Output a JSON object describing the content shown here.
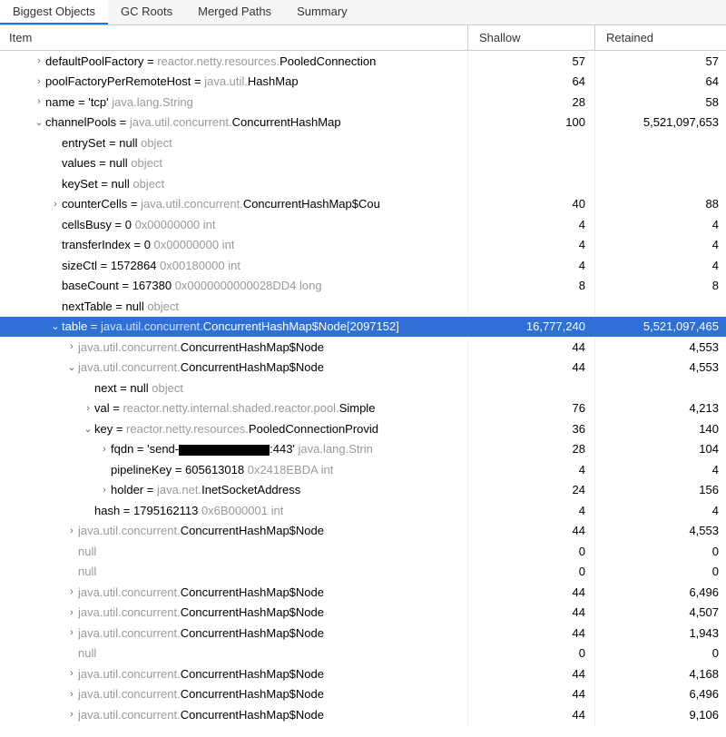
{
  "tabs": [
    {
      "label": "Biggest Objects",
      "active": true
    },
    {
      "label": "GC Roots",
      "active": false
    },
    {
      "label": "Merged Paths",
      "active": false
    },
    {
      "label": "Summary",
      "active": false
    }
  ],
  "columns": {
    "item": "Item",
    "shallow": "Shallow",
    "retained": "Retained"
  },
  "rows": [
    {
      "indent": 2,
      "arrow": "right",
      "parts": [
        {
          "t": "defaultPoolFactory = ",
          "c": "dark"
        },
        {
          "t": "reactor.netty.resources.",
          "c": "gray"
        },
        {
          "t": "PooledConnection",
          "c": "dark"
        }
      ],
      "shallow": "57",
      "retained": "57"
    },
    {
      "indent": 2,
      "arrow": "right",
      "parts": [
        {
          "t": "poolFactoryPerRemoteHost = ",
          "c": "dark"
        },
        {
          "t": "java.util.",
          "c": "gray"
        },
        {
          "t": "HashMap",
          "c": "dark"
        }
      ],
      "shallow": "64",
      "retained": "64"
    },
    {
      "indent": 2,
      "arrow": "right",
      "parts": [
        {
          "t": "name = 'tcp' ",
          "c": "dark"
        },
        {
          "t": "java.lang.String",
          "c": "gray"
        }
      ],
      "shallow": "28",
      "retained": "58"
    },
    {
      "indent": 2,
      "arrow": "down",
      "parts": [
        {
          "t": "channelPools = ",
          "c": "dark"
        },
        {
          "t": "java.util.concurrent.",
          "c": "gray"
        },
        {
          "t": "ConcurrentHashMap",
          "c": "dark"
        }
      ],
      "shallow": "100",
      "retained": "5,521,097,653"
    },
    {
      "indent": 3,
      "arrow": "none",
      "parts": [
        {
          "t": "entrySet = null ",
          "c": "dark"
        },
        {
          "t": "object",
          "c": "gray"
        }
      ],
      "shallow": "",
      "retained": ""
    },
    {
      "indent": 3,
      "arrow": "none",
      "parts": [
        {
          "t": "values = null ",
          "c": "dark"
        },
        {
          "t": "object",
          "c": "gray"
        }
      ],
      "shallow": "",
      "retained": ""
    },
    {
      "indent": 3,
      "arrow": "none",
      "parts": [
        {
          "t": "keySet = null ",
          "c": "dark"
        },
        {
          "t": "object",
          "c": "gray"
        }
      ],
      "shallow": "",
      "retained": ""
    },
    {
      "indent": 3,
      "arrow": "right",
      "parts": [
        {
          "t": "counterCells = ",
          "c": "dark"
        },
        {
          "t": "java.util.concurrent.",
          "c": "gray"
        },
        {
          "t": "ConcurrentHashMap$Cou",
          "c": "dark"
        }
      ],
      "shallow": "40",
      "retained": "88"
    },
    {
      "indent": 3,
      "arrow": "none",
      "parts": [
        {
          "t": "cellsBusy = 0 ",
          "c": "dark"
        },
        {
          "t": "0x00000000  int",
          "c": "gray"
        }
      ],
      "shallow": "4",
      "retained": "4"
    },
    {
      "indent": 3,
      "arrow": "none",
      "parts": [
        {
          "t": "transferIndex = 0 ",
          "c": "dark"
        },
        {
          "t": "0x00000000  int",
          "c": "gray"
        }
      ],
      "shallow": "4",
      "retained": "4"
    },
    {
      "indent": 3,
      "arrow": "none",
      "parts": [
        {
          "t": "sizeCtl = 1572864 ",
          "c": "dark"
        },
        {
          "t": "0x00180000  int",
          "c": "gray"
        }
      ],
      "shallow": "4",
      "retained": "4"
    },
    {
      "indent": 3,
      "arrow": "none",
      "parts": [
        {
          "t": "baseCount = 167380 ",
          "c": "dark"
        },
        {
          "t": "0x0000000000028DD4  long",
          "c": "gray"
        }
      ],
      "shallow": "8",
      "retained": "8"
    },
    {
      "indent": 3,
      "arrow": "none",
      "parts": [
        {
          "t": "nextTable = null ",
          "c": "dark"
        },
        {
          "t": "object",
          "c": "gray"
        }
      ],
      "shallow": "",
      "retained": ""
    },
    {
      "indent": 3,
      "arrow": "down",
      "selected": true,
      "parts": [
        {
          "t": "table = ",
          "c": "dark"
        },
        {
          "t": "java.util.concurrent.",
          "c": "gray"
        },
        {
          "t": "ConcurrentHashMap$Node[2097152]",
          "c": "dark"
        }
      ],
      "shallow": "16,777,240",
      "retained": "5,521,097,465"
    },
    {
      "indent": 4,
      "arrow": "right",
      "parts": [
        {
          "t": "java.util.concurrent.",
          "c": "gray"
        },
        {
          "t": "ConcurrentHashMap$Node",
          "c": "dark"
        }
      ],
      "shallow": "44",
      "retained": "4,553"
    },
    {
      "indent": 4,
      "arrow": "down",
      "parts": [
        {
          "t": "java.util.concurrent.",
          "c": "gray"
        },
        {
          "t": "ConcurrentHashMap$Node",
          "c": "dark"
        }
      ],
      "shallow": "44",
      "retained": "4,553"
    },
    {
      "indent": 5,
      "arrow": "none",
      "parts": [
        {
          "t": "next = null ",
          "c": "dark"
        },
        {
          "t": "object",
          "c": "gray"
        }
      ],
      "shallow": "",
      "retained": ""
    },
    {
      "indent": 5,
      "arrow": "right",
      "parts": [
        {
          "t": "val = ",
          "c": "dark"
        },
        {
          "t": "reactor.netty.internal.shaded.reactor.pool.",
          "c": "gray"
        },
        {
          "t": "Simple",
          "c": "dark"
        }
      ],
      "shallow": "76",
      "retained": "4,213"
    },
    {
      "indent": 5,
      "arrow": "down",
      "parts": [
        {
          "t": "key = ",
          "c": "dark"
        },
        {
          "t": "reactor.netty.resources.",
          "c": "gray"
        },
        {
          "t": "PooledConnectionProvid",
          "c": "dark"
        }
      ],
      "shallow": "36",
      "retained": "140"
    },
    {
      "indent": 6,
      "arrow": "right",
      "parts": [
        {
          "t": "fqdn = 'send-",
          "c": "dark"
        },
        {
          "t": "",
          "c": "redact"
        },
        {
          "t": ":443' ",
          "c": "dark"
        },
        {
          "t": "java.lang.Strin",
          "c": "gray"
        }
      ],
      "shallow": "28",
      "retained": "104"
    },
    {
      "indent": 6,
      "arrow": "none",
      "parts": [
        {
          "t": "pipelineKey = 605613018 ",
          "c": "dark"
        },
        {
          "t": "0x2418EBDA  int",
          "c": "gray"
        }
      ],
      "shallow": "4",
      "retained": "4"
    },
    {
      "indent": 6,
      "arrow": "right",
      "parts": [
        {
          "t": "holder = ",
          "c": "dark"
        },
        {
          "t": "java.net.",
          "c": "gray"
        },
        {
          "t": "InetSocketAddress",
          "c": "dark"
        }
      ],
      "shallow": "24",
      "retained": "156"
    },
    {
      "indent": 5,
      "arrow": "none",
      "parts": [
        {
          "t": "hash = 1795162113 ",
          "c": "dark"
        },
        {
          "t": "0x6B000001  int",
          "c": "gray"
        }
      ],
      "shallow": "4",
      "retained": "4"
    },
    {
      "indent": 4,
      "arrow": "right",
      "parts": [
        {
          "t": "java.util.concurrent.",
          "c": "gray"
        },
        {
          "t": "ConcurrentHashMap$Node",
          "c": "dark"
        }
      ],
      "shallow": "44",
      "retained": "4,553"
    },
    {
      "indent": 4,
      "arrow": "none",
      "parts": [
        {
          "t": "null",
          "c": "gray"
        }
      ],
      "shallow": "0",
      "retained": "0"
    },
    {
      "indent": 4,
      "arrow": "none",
      "parts": [
        {
          "t": "null",
          "c": "gray"
        }
      ],
      "shallow": "0",
      "retained": "0"
    },
    {
      "indent": 4,
      "arrow": "right",
      "parts": [
        {
          "t": "java.util.concurrent.",
          "c": "gray"
        },
        {
          "t": "ConcurrentHashMap$Node",
          "c": "dark"
        }
      ],
      "shallow": "44",
      "retained": "6,496"
    },
    {
      "indent": 4,
      "arrow": "right",
      "parts": [
        {
          "t": "java.util.concurrent.",
          "c": "gray"
        },
        {
          "t": "ConcurrentHashMap$Node",
          "c": "dark"
        }
      ],
      "shallow": "44",
      "retained": "4,507"
    },
    {
      "indent": 4,
      "arrow": "right",
      "parts": [
        {
          "t": "java.util.concurrent.",
          "c": "gray"
        },
        {
          "t": "ConcurrentHashMap$Node",
          "c": "dark"
        }
      ],
      "shallow": "44",
      "retained": "1,943"
    },
    {
      "indent": 4,
      "arrow": "none",
      "parts": [
        {
          "t": "null",
          "c": "gray"
        }
      ],
      "shallow": "0",
      "retained": "0"
    },
    {
      "indent": 4,
      "arrow": "right",
      "parts": [
        {
          "t": "java.util.concurrent.",
          "c": "gray"
        },
        {
          "t": "ConcurrentHashMap$Node",
          "c": "dark"
        }
      ],
      "shallow": "44",
      "retained": "4,168"
    },
    {
      "indent": 4,
      "arrow": "right",
      "parts": [
        {
          "t": "java.util.concurrent.",
          "c": "gray"
        },
        {
          "t": "ConcurrentHashMap$Node",
          "c": "dark"
        }
      ],
      "shallow": "44",
      "retained": "6,496"
    },
    {
      "indent": 4,
      "arrow": "right",
      "parts": [
        {
          "t": "java.util.concurrent.",
          "c": "gray"
        },
        {
          "t": "ConcurrentHashMap$Node",
          "c": "dark"
        }
      ],
      "shallow": "44",
      "retained": "9,106"
    }
  ]
}
